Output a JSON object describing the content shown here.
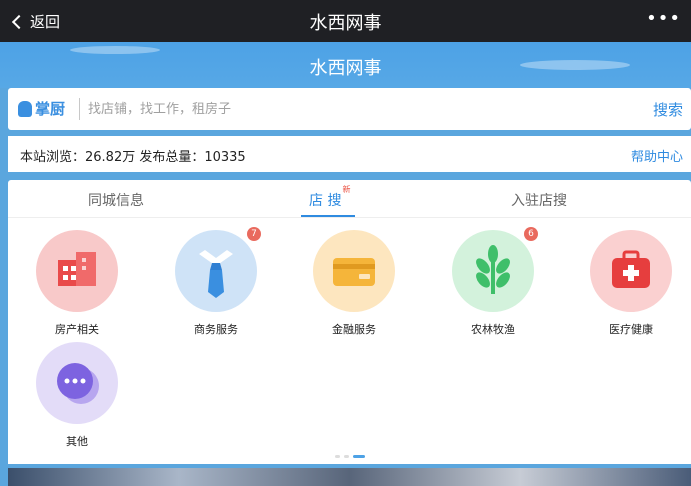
{
  "topbar": {
    "back_label": "返回",
    "title": "水西网事",
    "more": "•••"
  },
  "banner": {
    "title": "水西网事"
  },
  "search": {
    "logo_text": "掌厨",
    "placeholder": "找店铺，找工作，租房子",
    "button_label": "搜索"
  },
  "stats": {
    "text": "本站浏览：26.82万  发布总量：10335",
    "help_label": "帮助中心"
  },
  "tabs": [
    {
      "label": "同城信息",
      "active": false
    },
    {
      "label": "店 搜",
      "active": true,
      "badge": "新"
    },
    {
      "label": "入驻店搜",
      "active": false
    }
  ],
  "categories": [
    {
      "label": "房产相关",
      "icon": "building-icon",
      "color": "#f8c9c9",
      "badge": ""
    },
    {
      "label": "商务服务",
      "icon": "necktie-icon",
      "color": "#cfe3f7",
      "badge": "7"
    },
    {
      "label": "金融服务",
      "icon": "card-icon",
      "color": "#fde6bf",
      "badge": ""
    },
    {
      "label": "农林牧渔",
      "icon": "plant-icon",
      "color": "#d3f2dc",
      "badge": "6"
    },
    {
      "label": "医疗健康",
      "icon": "medical-kit-icon",
      "color": "#fad0d0",
      "badge": ""
    },
    {
      "label": "其他",
      "icon": "chat-bubble-icon",
      "color": "#e3dcf8",
      "badge": ""
    }
  ],
  "pager": {
    "total": 3,
    "active_index": 2
  }
}
